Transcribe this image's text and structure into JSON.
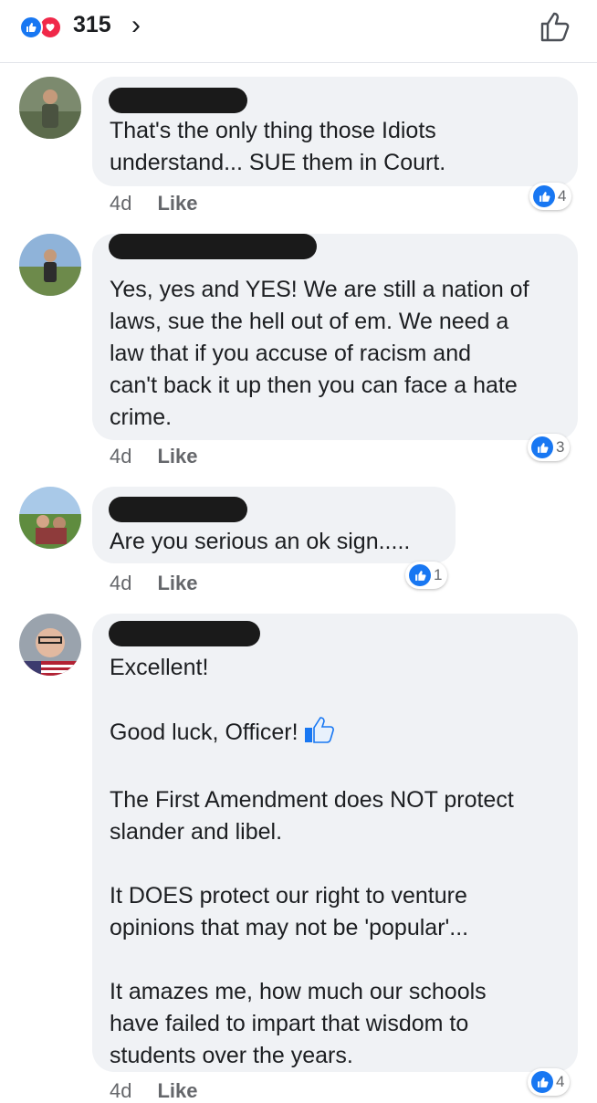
{
  "header": {
    "reaction_count": "315",
    "chevron": "›"
  },
  "comments": [
    {
      "time": "4d",
      "like_label": "Like",
      "reactions": "4",
      "lines": [
        "That's the only thing those Idiots",
        "understand... SUE them in Court."
      ]
    },
    {
      "time": "4d",
      "like_label": "Like",
      "reactions": "3",
      "lines": [
        "Yes, yes and YES! We are still a nation of",
        "laws, sue the hell out of em. We need a",
        "law that if you accuse of racism and",
        "can't back it up then you can face a hate",
        "crime."
      ]
    },
    {
      "time": "4d",
      "like_label": "Like",
      "reactions": "1",
      "lines": [
        "Are you serious an ok sign....."
      ]
    },
    {
      "time": "4d",
      "like_label": "Like",
      "reactions": "4",
      "lines": [
        "Excellent!",
        "",
        "Good luck, Officer!",
        "",
        "The First Amendment does NOT protect",
        "slander and libel.",
        "",
        "It DOES protect our right to venture",
        "opinions that may not be 'popular'...",
        "",
        "It amazes me, how much our schools",
        "have failed to impart that wisdom to",
        "students over the years."
      ]
    }
  ]
}
